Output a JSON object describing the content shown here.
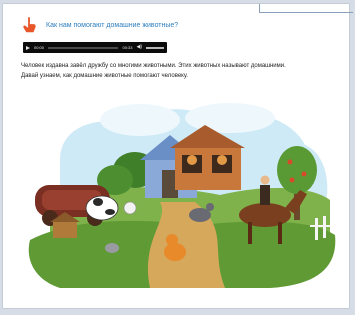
{
  "lesson": {
    "title_link": "Как нам помогают домашние животные?",
    "description_line1": "Человек издавна завёл дружбу со многими животными. Этих животных называют домашними.",
    "description_line2": "Давай узнаем, как домашние животные помогают человеку."
  },
  "audio": {
    "current_time": "00:00",
    "duration": "00:33",
    "progress": 0.0,
    "volume": 0.8
  },
  "icons": {
    "header": "pointing-hand-icon",
    "play": "play-icon",
    "volume": "speaker-icon"
  },
  "colors": {
    "link": "#2e7fbf",
    "icon_orange": "#e8562a",
    "player_bg": "#0b0b0b"
  }
}
